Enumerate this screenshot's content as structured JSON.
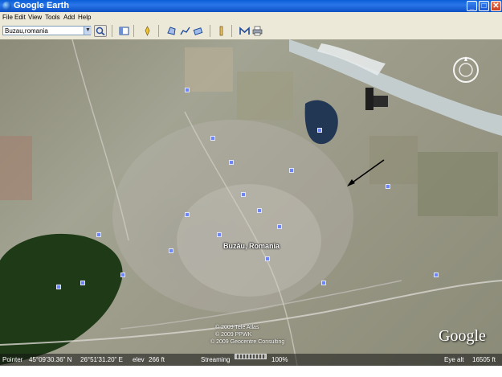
{
  "window": {
    "title": "Google Earth",
    "controls": {
      "minimize": "_",
      "maximize": "□",
      "close": "✕"
    }
  },
  "menu": {
    "items": [
      "File",
      "Edit",
      "View",
      "Tools",
      "Add",
      "Help"
    ]
  },
  "toolbar": {
    "search_value": "Buzau,romania",
    "tools": [
      "sidebar-icon",
      "placemark-icon",
      "polygon-icon",
      "path-icon",
      "overlay-icon",
      "ruler-icon",
      "email-icon",
      "print-icon"
    ]
  },
  "map": {
    "city_label": "Buzău, Romania",
    "logo": "Google",
    "copyrights": [
      "© 2009 Tele Atlas",
      "© 2009 PPWK",
      "© 2009 Geocentre Consulting"
    ]
  },
  "status": {
    "pointer_label": "Pointer",
    "pointer_lat": "45°09'30.36\" N",
    "pointer_lon": "26°51'31.20\" E",
    "elev_label": "elev",
    "elev_value": "266 ft",
    "streaming_label": "Streaming",
    "streaming_pct": "100%",
    "eye_alt_label": "Eye alt",
    "eye_alt_value": "16505 ft"
  },
  "colors": {
    "titlebar": "#0a5ed7",
    "chrome": "#ece9d8",
    "forest": "#1f3a16",
    "river": "#c9d3d6",
    "pins": "#6d86ff"
  }
}
